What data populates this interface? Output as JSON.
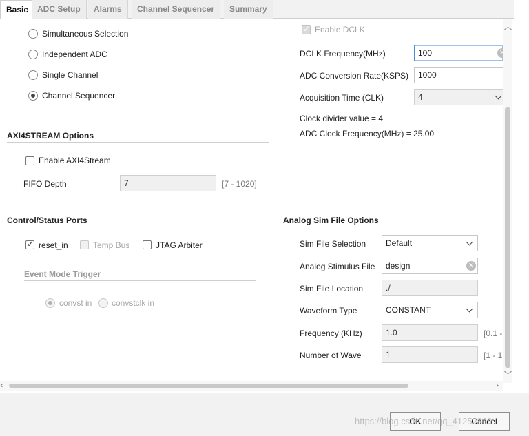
{
  "tabs": [
    "Basic",
    "ADC Setup",
    "Alarms",
    "Channel Sequencer",
    "Summary"
  ],
  "startup_modes": [
    {
      "label": "Simultaneous Selection",
      "checked": false
    },
    {
      "label": "Independent ADC",
      "checked": false
    },
    {
      "label": "Single Channel",
      "checked": false
    },
    {
      "label": "Channel Sequencer",
      "checked": true
    }
  ],
  "dclk": {
    "enable_label": "Enable DCLK",
    "enabled": true,
    "freq_label": "DCLK Frequency(MHz)",
    "freq_value": "100",
    "rate_label": "ADC Conversion Rate(KSPS)",
    "rate_value": "1000",
    "acq_label": "Acquisition Time (CLK)",
    "acq_value": "4",
    "divider_text": "Clock divider value = 4",
    "adc_clock_text": "ADC Clock Frequency(MHz) = 25.00"
  },
  "axi": {
    "title": "AXI4STREAM Options",
    "enable_label": "Enable AXI4Stream",
    "fifo_label": "FIFO Depth",
    "fifo_value": "7",
    "fifo_range": "[7 - 1020]"
  },
  "control": {
    "title": "Control/Status Ports",
    "reset_label": "reset_in",
    "temp_label": "Temp Bus",
    "jtag_label": "JTAG Arbiter",
    "event_title": "Event Mode Trigger",
    "convst_label": "convst in",
    "convstclk_label": "convstclk in"
  },
  "sim": {
    "title": "Analog Sim File Options",
    "selection_label": "Sim File Selection",
    "selection_value": "Default",
    "stimulus_label": "Analog Stimulus File",
    "stimulus_value": "design",
    "location_label": "Sim File Location",
    "location_value": "./",
    "waveform_label": "Waveform Type",
    "waveform_value": "CONSTANT",
    "freq_label": "Frequency (KHz)",
    "freq_value": "1.0",
    "freq_range": "[0.1 -",
    "waves_label": "Number of Wave",
    "waves_value": "1",
    "waves_range": "[1 - 1"
  },
  "buttons": {
    "ok": "OK",
    "cancel": "Cancel"
  },
  "watermark": "https://blog.csdn.net/qq_41252869"
}
